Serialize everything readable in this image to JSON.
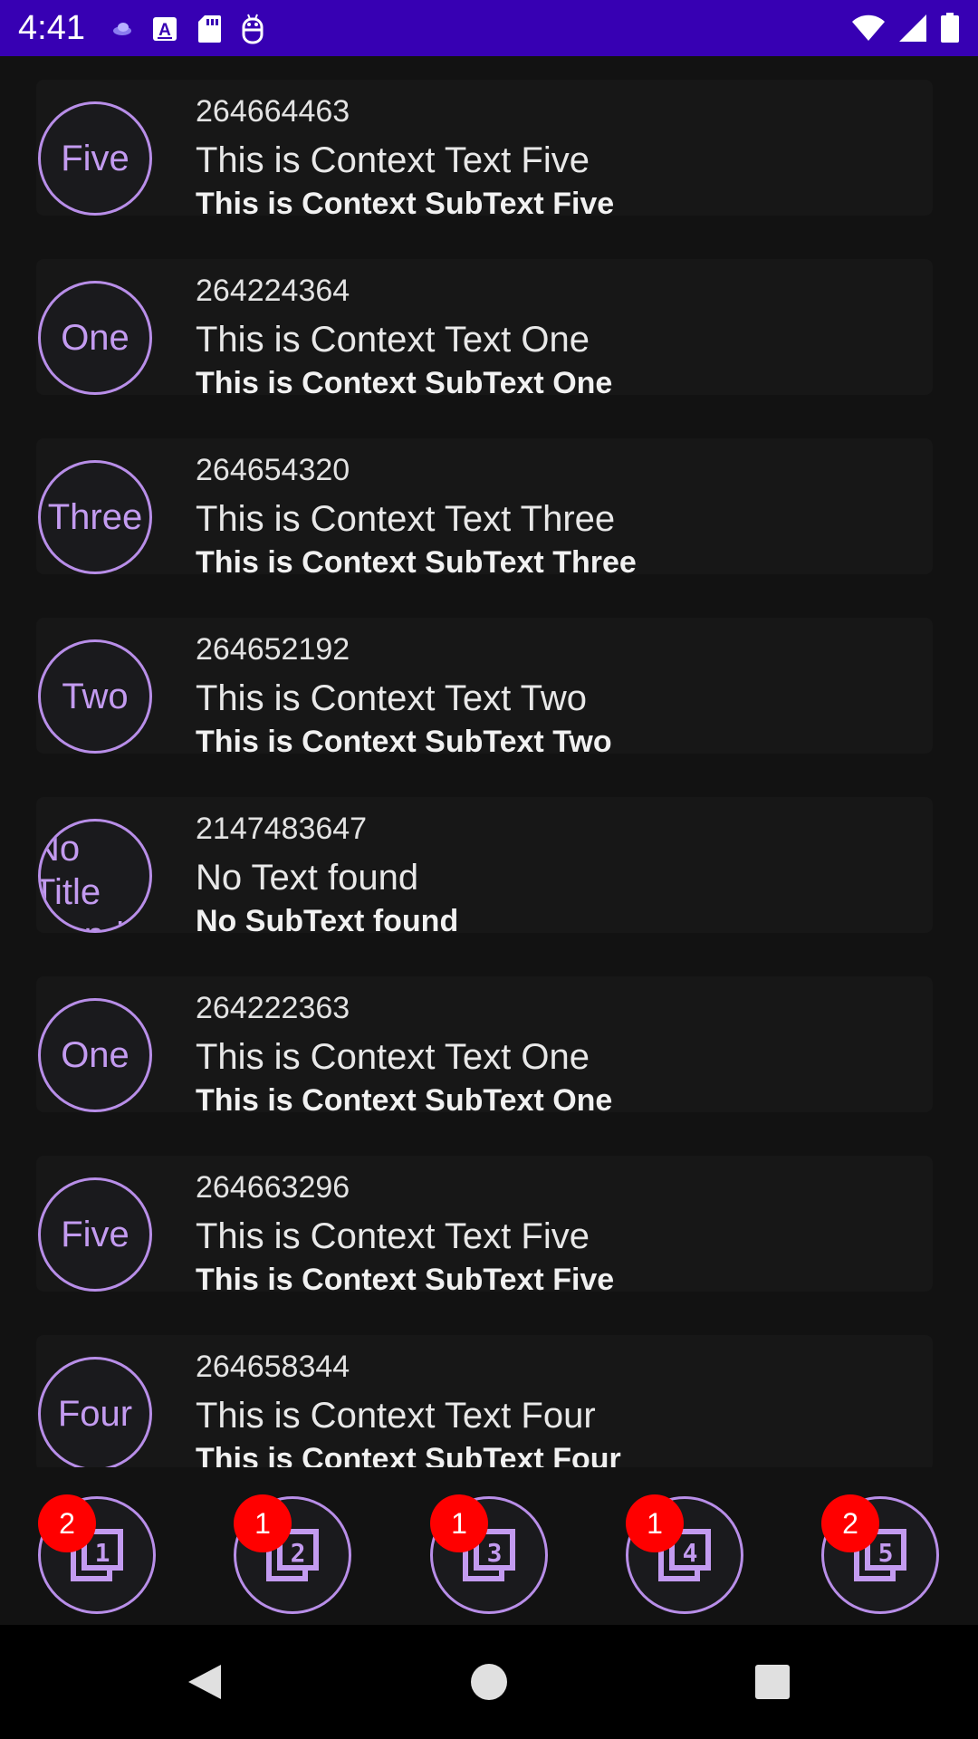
{
  "status_bar": {
    "time": "4:41",
    "left_icons": [
      "cloud-icon",
      "font-a-icon",
      "sd-card-icon",
      "android-robot-icon"
    ],
    "right_icons": [
      "wifi-icon",
      "cellular-signal-icon",
      "battery-icon"
    ]
  },
  "list": {
    "items": [
      {
        "id": "264664463",
        "avatar": "Five",
        "title": "This is Context Text Five",
        "subtitle": "This is Context SubText Five"
      },
      {
        "id": "264224364",
        "avatar": "One",
        "title": "This is Context Text One",
        "subtitle": "This is Context SubText One"
      },
      {
        "id": "264654320",
        "avatar": "Three",
        "title": "This is Context Text Three",
        "subtitle": "This is Context SubText Three"
      },
      {
        "id": "264652192",
        "avatar": "Two",
        "title": "This is Context Text Two",
        "subtitle": "This is Context SubText Two"
      },
      {
        "id": "2147483647",
        "avatar": "No Title found",
        "title": "No Text found",
        "subtitle": "No SubText found"
      },
      {
        "id": "264222363",
        "avatar": "One",
        "title": "This is Context Text One",
        "subtitle": "This is Context SubText One"
      },
      {
        "id": "264663296",
        "avatar": "Five",
        "title": "This is Context Text Five",
        "subtitle": "This is Context SubText Five"
      },
      {
        "id": "264658344",
        "avatar": "Four",
        "title": "This is Context Text Four",
        "subtitle": "This is Context SubText Four"
      }
    ]
  },
  "tab_bar": {
    "tabs": [
      {
        "icon": "filter-1-icon",
        "badge": "2"
      },
      {
        "icon": "filter-2-icon",
        "badge": "1"
      },
      {
        "icon": "filter-3-icon",
        "badge": "1"
      },
      {
        "icon": "filter-4-icon",
        "badge": "1"
      },
      {
        "icon": "filter-5-icon",
        "badge": "2"
      }
    ]
  },
  "nav_bar": {
    "buttons": [
      "back-icon",
      "home-icon",
      "recents-icon"
    ]
  },
  "colors": {
    "status_bar": "#3700b3",
    "background": "#121212",
    "accent": "#bb86fc",
    "badge": "#ff0000"
  }
}
